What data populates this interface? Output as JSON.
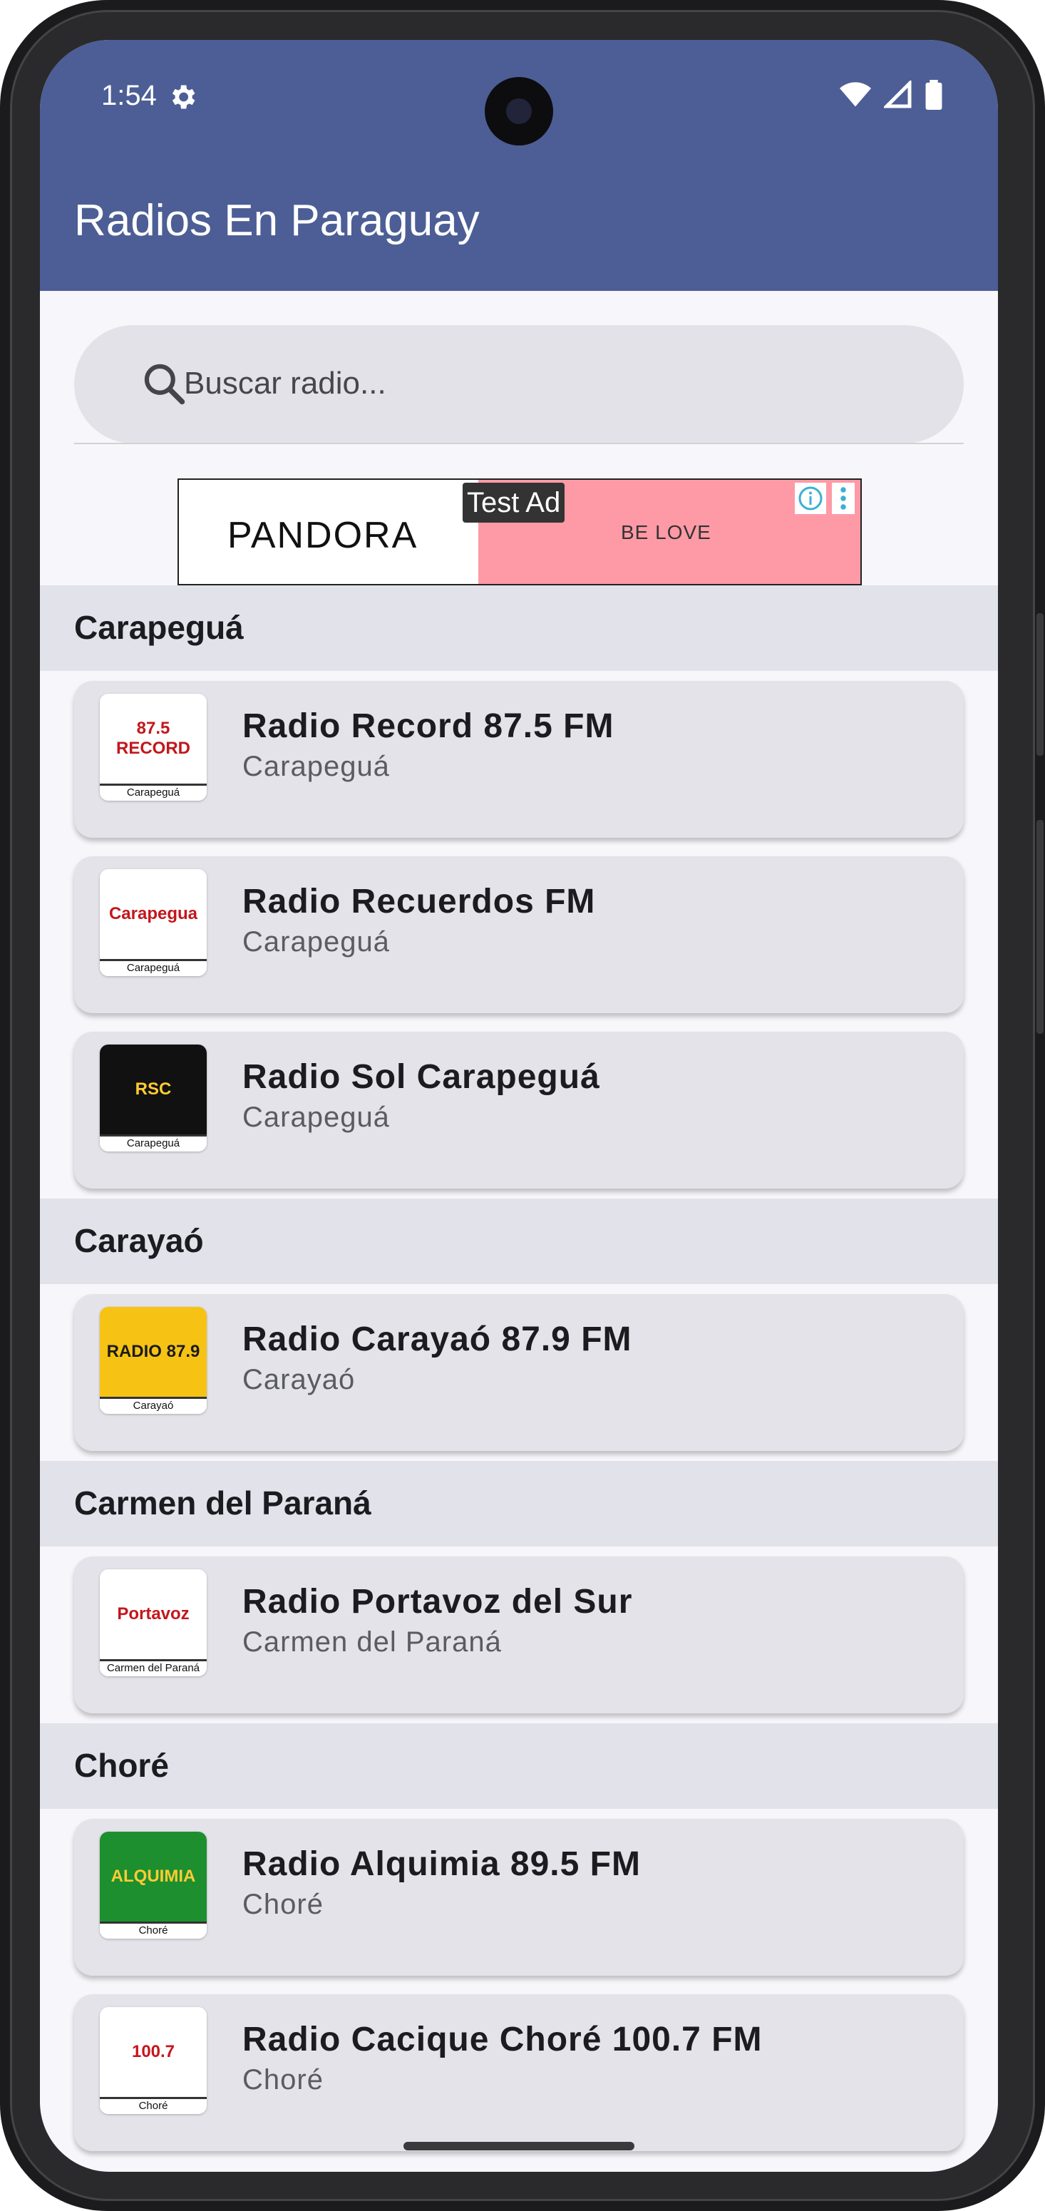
{
  "status_bar": {
    "time": "1:54"
  },
  "app": {
    "title": "Radios En Paraguay"
  },
  "search": {
    "placeholder": "Buscar radio..."
  },
  "ad": {
    "label": "Test Ad",
    "brand": "PANDORA",
    "tagline": "BE LOVE"
  },
  "sections": [
    {
      "title": "Carapeguá",
      "stations": [
        {
          "name": "Radio Record 87.5 FM",
          "location": "Carapeguá",
          "logo_caption": "Carapeguá",
          "logo_text": "87.5 RECORD",
          "logo_bg": "#ffffff"
        },
        {
          "name": "Radio Recuerdos FM",
          "location": "Carapeguá",
          "logo_caption": "Carapeguá",
          "logo_text": "Carapegua",
          "logo_bg": "#ffffff"
        },
        {
          "name": "Radio Sol Carapeguá",
          "location": "Carapeguá",
          "logo_caption": "Carapeguá",
          "logo_text": "RSC",
          "logo_bg": "#111111"
        }
      ]
    },
    {
      "title": "Carayaó",
      "stations": [
        {
          "name": "Radio Carayaó 87.9 FM",
          "location": "Carayaó",
          "logo_caption": "Carayaó",
          "logo_text": "RADIO 87.9",
          "logo_bg": "#f6c315"
        }
      ]
    },
    {
      "title": "Carmen del Paraná",
      "stations": [
        {
          "name": "Radio Portavoz del Sur",
          "location": "Carmen del Paraná",
          "logo_caption": "Carmen del Paraná",
          "logo_text": "Portavoz",
          "logo_bg": "#ffffff"
        }
      ]
    },
    {
      "title": "Choré",
      "stations": [
        {
          "name": "Radio Alquimia 89.5 FM",
          "location": "Choré",
          "logo_caption": "Choré",
          "logo_text": "ALQUIMIA",
          "logo_bg": "#1d8f2f"
        },
        {
          "name": "Radio Cacique Choré 100.7 FM",
          "location": "Choré",
          "logo_caption": "Choré",
          "logo_text": "100.7",
          "logo_bg": "#ffffff"
        }
      ]
    }
  ],
  "colors": {
    "app_bar": "#4c5e95",
    "section_bg": "#e2e2ea",
    "card_bg": "#e4e3e9",
    "screen_bg": "#f6f6fb"
  }
}
